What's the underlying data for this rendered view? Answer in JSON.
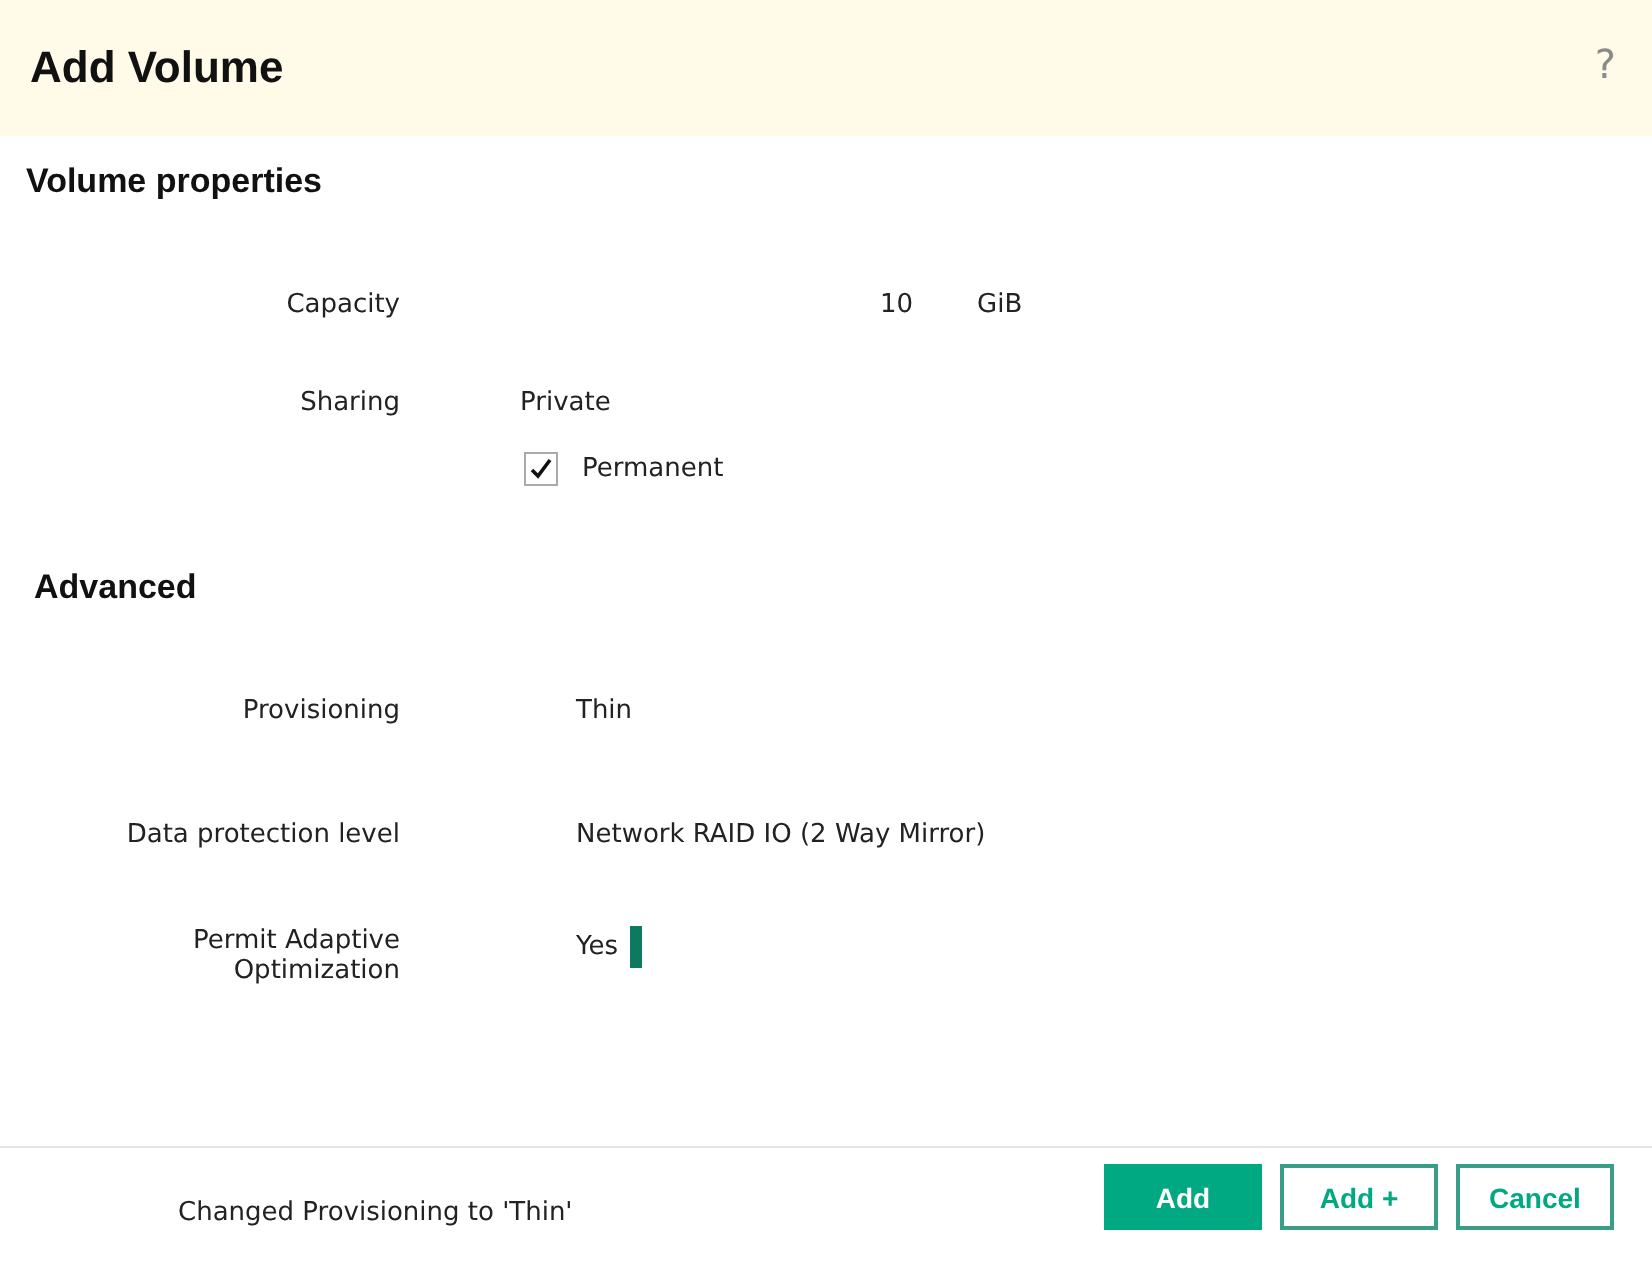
{
  "dialog": {
    "title": "Add Volume",
    "help": "?"
  },
  "volume_properties": {
    "heading": "Volume properties",
    "capacity": {
      "label": "Capacity",
      "value": "10",
      "unit": "GiB"
    },
    "sharing": {
      "label": "Sharing",
      "value": "Private",
      "permanent": {
        "label": "Permanent",
        "checked": true
      }
    }
  },
  "advanced": {
    "heading": "Advanced",
    "rows": [
      {
        "label": "Provisioning",
        "value": "Thin"
      },
      {
        "label": "Data protection level",
        "value": "Network RAID IO (2 Way Mirror)"
      },
      {
        "label": "Permit Adaptive Optimization",
        "value": "Yes",
        "cursor": true
      }
    ]
  },
  "status": "Changed Provisioning to 'Thin'",
  "buttons": [
    {
      "label": "Add",
      "kind": "primary"
    },
    {
      "label": "Add +",
      "kind": "secondary"
    },
    {
      "label": "Cancel",
      "kind": "secondary"
    }
  ]
}
